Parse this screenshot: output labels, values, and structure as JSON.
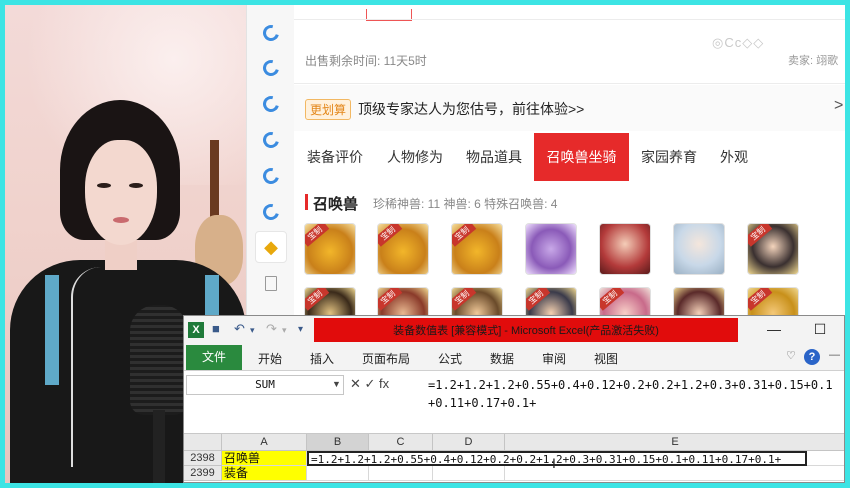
{
  "site": {
    "sale_time": "出售剩余时间: 11天5时",
    "seller": "卖家: 翊歌",
    "banner_badge": "更划算",
    "banner_text": "顶级专家达人为您估号，前往体验>>",
    "banner_arrow": ">",
    "tabs": [
      {
        "label": "装备评价",
        "active": false
      },
      {
        "label": "人物修为",
        "active": false
      },
      {
        "label": "物品道具",
        "active": false
      },
      {
        "label": "召唤兽坐骑",
        "active": true
      },
      {
        "label": "家园养育",
        "active": false
      },
      {
        "label": "外观",
        "active": false
      }
    ],
    "pet_section_title": "召唤兽",
    "pet_stats": "珍稀神兽: 11   神兽: 6   特殊召唤兽: 4",
    "pet_badge": "宝制"
  },
  "excel": {
    "window_title": "装备数值表 [兼容模式] - Microsoft Excel(产品激活失败)",
    "logo": "X",
    "min_label": "—",
    "max_label": "☐",
    "ribbon_tabs": [
      "文件",
      "开始",
      "插入",
      "页面布局",
      "公式",
      "数据",
      "审阅",
      "视图"
    ],
    "help_label": "?",
    "name_box": "SUM",
    "formula_buttons": "✕ ✓ fx",
    "formula_text": "=1.2+1.2+1.2+0.55+0.4+0.12+0.2+0.2+1.2+0.3+0.31+0.15+0.1+0.11+0.17+0.1+",
    "columns": [
      "A",
      "B",
      "C",
      "D",
      "E"
    ],
    "rows": [
      {
        "num": "2398",
        "a": "召唤兽",
        "b_edit": "=1.2+1.2+1.2+0.55+0.4+0.12+0.2+0.2+1.2+0.3+0.31+0.15+0.1+0.11+0.17+0.1+"
      },
      {
        "num": "2399",
        "a": "装备",
        "b_edit": ""
      }
    ]
  },
  "colors": {
    "frame": "#3ce4e4",
    "tab_active": "#e62a2a",
    "excel_green": "#2a8a3e",
    "title_red": "#e10c0c",
    "cell_yellow": "#ffff00"
  }
}
